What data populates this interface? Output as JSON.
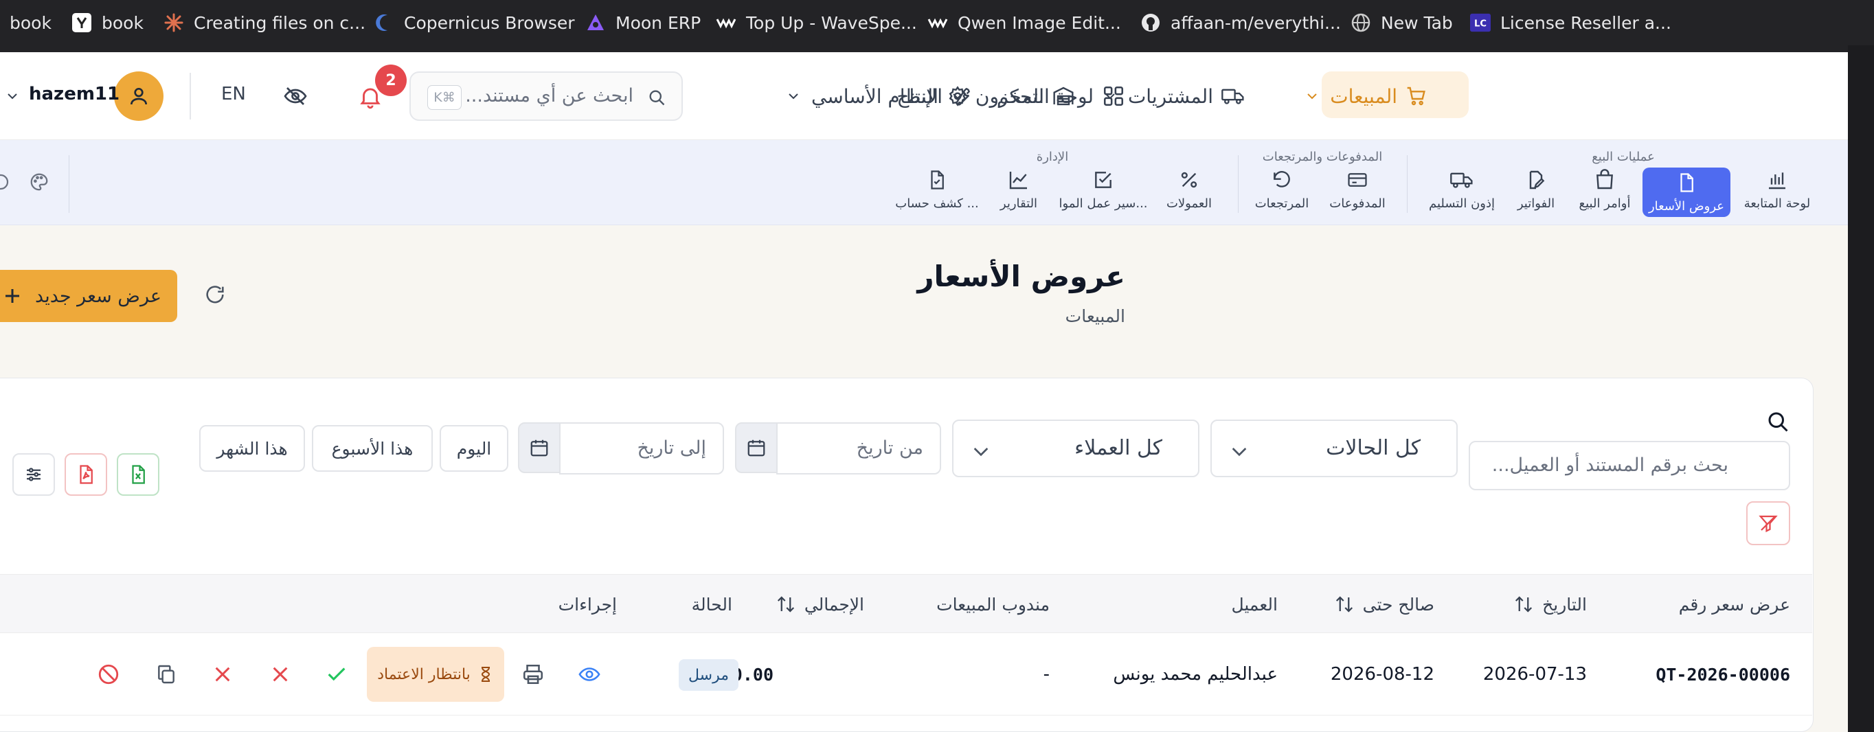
{
  "bookmarks": [
    {
      "label": "book",
      "icon": "generic-page-icon"
    },
    {
      "label": "book",
      "icon": "y-logo-icon"
    },
    {
      "label": "Creating files on c...",
      "icon": "sunburst-icon"
    },
    {
      "label": "Copernicus Browser",
      "icon": "crescent-icon"
    },
    {
      "label": "Moon ERP",
      "icon": "moon-logo-icon"
    },
    {
      "label": "Top Up - WaveSpe...",
      "icon": "wave-logo-icon"
    },
    {
      "label": "Qwen Image Edit...",
      "icon": "wave-logo-icon"
    },
    {
      "label": "affaan-m/everythi...",
      "icon": "github-icon"
    },
    {
      "label": "New Tab",
      "icon": "globe-icon"
    },
    {
      "label": "License Reseller a...",
      "icon": "lc-logo-icon"
    }
  ],
  "nav": {
    "dashboard": "لوحة التحكم",
    "core_system": "النظام الأساسي",
    "sales": "المبيعات",
    "purchases": "المشتريات",
    "inventory": "المخزون",
    "production": "الإنتاج",
    "search_placeholder": "ابحث عن أي مستند...",
    "shortcut": "K⌘",
    "notification_count": "2",
    "language": "EN",
    "username": "hazem11"
  },
  "subnav": {
    "groups": {
      "sales_ops": "عمليات البيع",
      "payments_returns": "المدفوعات والمرتجعات",
      "management": "الإدارة"
    },
    "items": {
      "monitoring": "لوحة المتابعة",
      "quotations": "عروض الأسعار",
      "sales_orders": "أوامر البيع",
      "invoices": "الفواتير",
      "delivery_notes": "إذون التسليم",
      "payments": "المدفوعات",
      "returns": "المرتجعات",
      "commissions": "العمولات",
      "workflow": "سير عمل الموا...",
      "reports": "التقارير",
      "statement": "كشف حساب ..."
    }
  },
  "page": {
    "title": "عروض الأسعار",
    "subtitle": "المبيعات",
    "new_button": "عرض سعر جديد"
  },
  "filters": {
    "search_placeholder": "بحث برقم المستند أو العميل...",
    "status_select": "كل الحالات",
    "customer_select": "كل العملاء",
    "from_date": "من تاريخ",
    "to_date": "إلى تاريخ",
    "today": "اليوم",
    "this_week": "هذا الأسبوع",
    "this_month": "هذا الشهر"
  },
  "table": {
    "headers": {
      "number": "عرض سعر رقم",
      "date": "التاريخ",
      "valid_until": "صالح حتى",
      "customer": "العميل",
      "sales_rep": "مندوب المبيعات",
      "total": "الإجمالي",
      "status": "الحالة",
      "actions": "إجراءات"
    },
    "rows": [
      {
        "number": "QT-2026-00006",
        "date": "2026-07-13",
        "valid_until": "2026-08-12",
        "customer": "عبدالحليم محمد يونس",
        "sales_rep": "-",
        "total": "60.00",
        "status": "مرسل",
        "approval": "بانتظار الاعتماد"
      }
    ]
  },
  "colors": {
    "accent": "#eea93a",
    "active_tab": "#4f6bf0",
    "danger": "#e5484d",
    "success": "#22c55e"
  }
}
